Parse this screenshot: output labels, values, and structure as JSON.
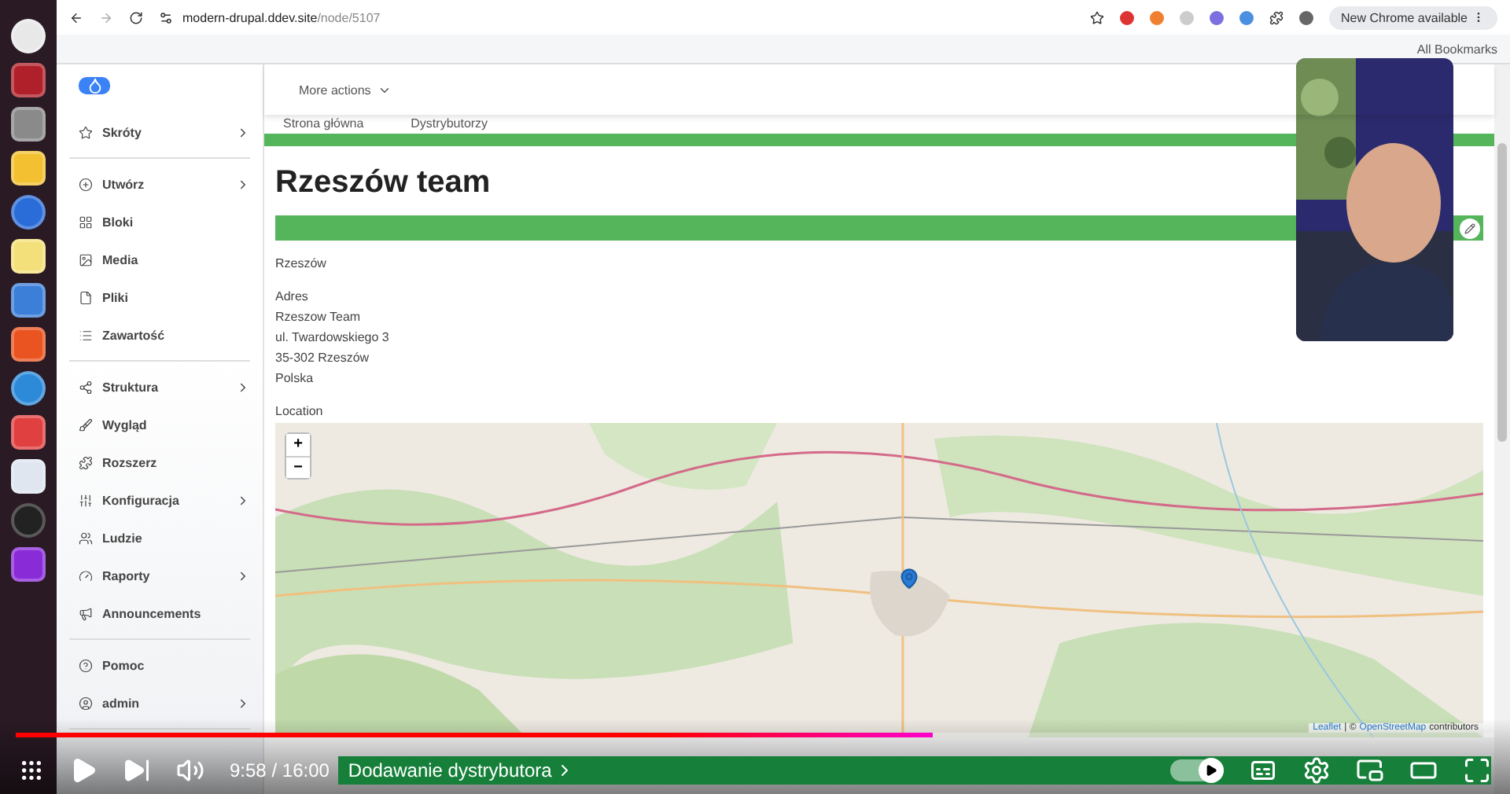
{
  "browser": {
    "url_host": "modern-drupal.ddev.site",
    "url_path": "/node/5107",
    "update_badge": "New Chrome available",
    "bookmarks_label": "All Bookmarks"
  },
  "sidebar": {
    "groups": [
      [
        {
          "label": "Skróty",
          "has_submenu": true
        }
      ],
      [
        {
          "label": "Utwórz",
          "has_submenu": true
        },
        {
          "label": "Bloki",
          "has_submenu": false
        },
        {
          "label": "Media",
          "has_submenu": false
        },
        {
          "label": "Pliki",
          "has_submenu": false
        },
        {
          "label": "Zawartość",
          "has_submenu": false
        }
      ],
      [
        {
          "label": "Struktura",
          "has_submenu": true
        },
        {
          "label": "Wygląd",
          "has_submenu": false
        },
        {
          "label": "Rozszerz",
          "has_submenu": false
        },
        {
          "label": "Konfiguracja",
          "has_submenu": true
        },
        {
          "label": "Ludzie",
          "has_submenu": false
        },
        {
          "label": "Raporty",
          "has_submenu": true
        },
        {
          "label": "Announcements",
          "has_submenu": false
        }
      ]
    ],
    "footer": [
      {
        "label": "Pomoc",
        "has_submenu": false
      },
      {
        "label": "admin",
        "has_submenu": true
      }
    ]
  },
  "toolbar": {
    "more_actions": "More actions"
  },
  "tabs": [
    {
      "label": "Strona główna"
    },
    {
      "label": "Dystrybutorzy"
    }
  ],
  "page": {
    "title": "Rzeszów team",
    "city": "Rzeszów",
    "address_label": "Adres",
    "address_lines": [
      "Rzeszow Team",
      "ul. Twardowskiego 3",
      "35-302 Rzeszów",
      "Polska"
    ],
    "location_label": "Location"
  },
  "map": {
    "zoom_in": "+",
    "zoom_out": "−",
    "attribution_link": "Leaflet",
    "attribution_separator": "| ©",
    "attribution_source": "OpenStreetMap",
    "attribution_suffix": "contributors"
  },
  "player": {
    "current_time": "9:58",
    "separator": "/",
    "duration": "16:00",
    "chapter": "Dodawanie dystrybutora",
    "level": 0.62,
    "autoplay_on": true
  }
}
